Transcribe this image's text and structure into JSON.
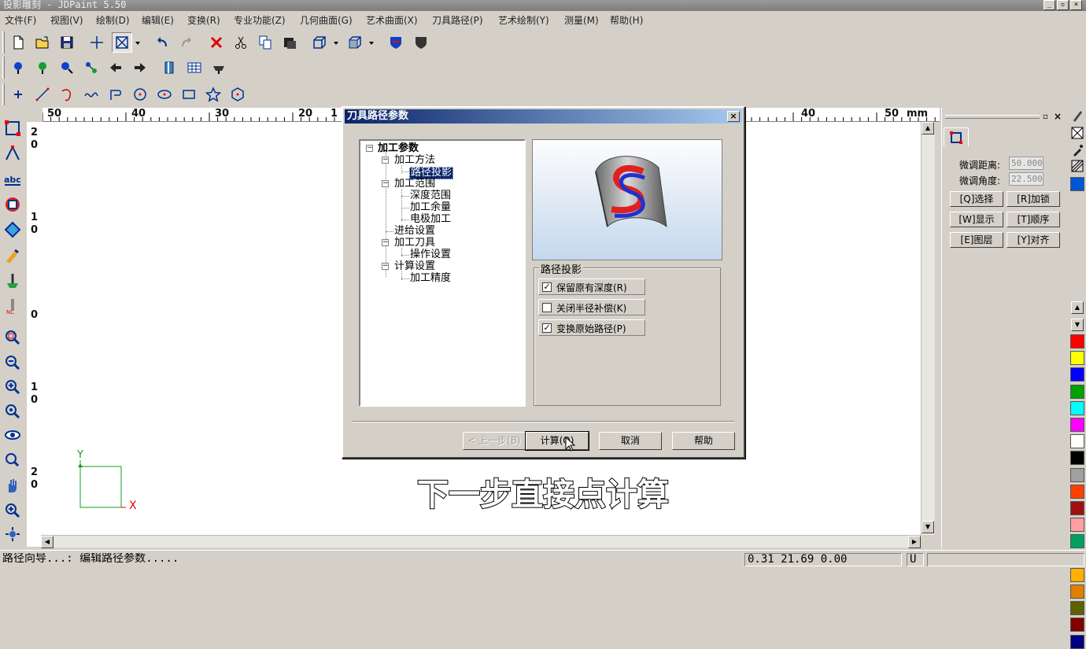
{
  "app": {
    "title": "投影雕刻 - JDPaint 5.50"
  },
  "menu": [
    "文件(F)",
    "视图(V)",
    "绘制(D)",
    "编辑(E)",
    "变换(R)",
    "专业功能(Z)",
    "几何曲面(G)",
    "艺术曲面(X)",
    "刀具路径(P)",
    "艺术绘制(Y)",
    "测量(M)",
    "帮助(H)"
  ],
  "ruler": {
    "unit": "mm",
    "h_left": [
      "50",
      "40",
      "30",
      "20",
      "1"
    ],
    "h_right": [
      "40",
      "50"
    ],
    "v": [
      "2",
      "0",
      "1",
      "0",
      "0",
      "1",
      "0",
      "2",
      "0"
    ]
  },
  "axes": {
    "x": "X",
    "y": "Y"
  },
  "dialog": {
    "title": "刀具路径参数",
    "tree": {
      "root": "加工参数",
      "method": "加工方法",
      "method_child": "路径投影",
      "range": "加工范围",
      "range_children": [
        "深度范围",
        "加工余量",
        "电极加工"
      ],
      "feed": "进给设置",
      "tool": "加工刀具",
      "tool_child": "操作设置",
      "calc": "计算设置",
      "calc_child": "加工精度"
    },
    "group_label": "路径投影",
    "options": [
      {
        "label": "保留原有深度(R)",
        "checked": true
      },
      {
        "label": "关闭半径补偿(K)",
        "checked": false
      },
      {
        "label": "变换原始路径(P)",
        "checked": true
      }
    ],
    "buttons": {
      "prev": "< 上一步(B)",
      "calc": "计算(Q)",
      "cancel": "取消",
      "help": "帮助"
    }
  },
  "right_panel": {
    "fine_dist_label": "微调距离:",
    "fine_dist_value": "50.000",
    "fine_angle_label": "微调角度:",
    "fine_angle_value": "22.500",
    "buttons": [
      "[Q]选择",
      "[R]加锁",
      "[W]显示",
      "[T]顺序",
      "[E]图层",
      "[Y]对齐"
    ]
  },
  "palette": [
    "#0055d4",
    "#ff0000",
    "#ffff00",
    "#0000ff",
    "#00a000",
    "#00ffff",
    "#ff00ff",
    "#ffffff",
    "#000000",
    "#a0a0a0",
    "#ff4000",
    "#a01010",
    "#ffa0a0",
    "#00a060",
    "#007070",
    "#ffb000",
    "#e08000",
    "#606000",
    "#800000",
    "#000080"
  ],
  "status": {
    "left": "路径向导...: 编辑路径参数.....",
    "coords": "0.31 21.69 0.00",
    "mode": "U"
  },
  "subtitle": "下一步直接点计算",
  "colors": {
    "title_start": "#0a246a",
    "title_end": "#a6caf0",
    "face": "#d4d0c8"
  }
}
